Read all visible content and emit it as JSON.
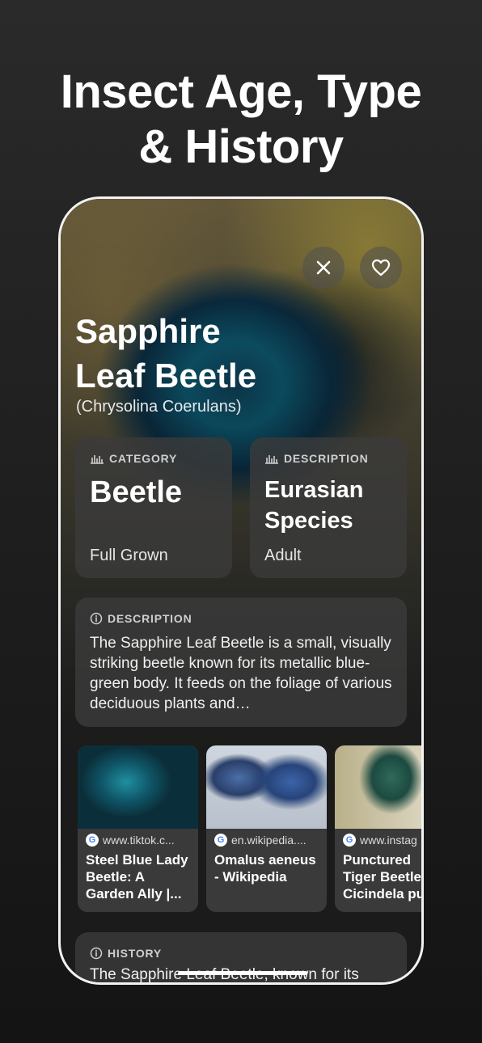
{
  "headline": {
    "line1": "Insect Age, Type",
    "line2": "& History"
  },
  "insect": {
    "name_line1": "Sapphire",
    "name_line2": "Leaf Beetle",
    "scientific": "(Chrysolina Coerulans)"
  },
  "cards": {
    "category": {
      "label": "CATEGORY",
      "value": "Beetle",
      "sub": "Full Grown",
      "icon": "chart-icon"
    },
    "description": {
      "label": "DESCRIPTION",
      "value_line1": "Eurasian",
      "value_line2": "Species",
      "sub": "Adult",
      "icon": "chart-icon"
    }
  },
  "about": {
    "label": "DESCRIPTION",
    "icon": "info-icon",
    "text": "The Sapphire Leaf Beetle is a small, visually striking beetle known for its metallic blue-green body. It feeds on the foliage of various deciduous plants and…"
  },
  "results": [
    {
      "source": "www.tiktok.c...",
      "title": "Steel Blue Lady Beetle: A Garden Ally |..."
    },
    {
      "source": "en.wikipedia....",
      "title": "Omalus aeneus - Wikipedia"
    },
    {
      "source": "www.instag",
      "title": "Punctured Tiger Beetle Cicindela pu"
    }
  ],
  "history": {
    "label": "HISTORY",
    "icon": "info-icon",
    "text": "The Sapphire Leaf Beetle, known for its"
  },
  "colors": {
    "card_bg": "#3a3a3a",
    "page_bg": "#1e1e1e",
    "text": "#ffffff"
  }
}
